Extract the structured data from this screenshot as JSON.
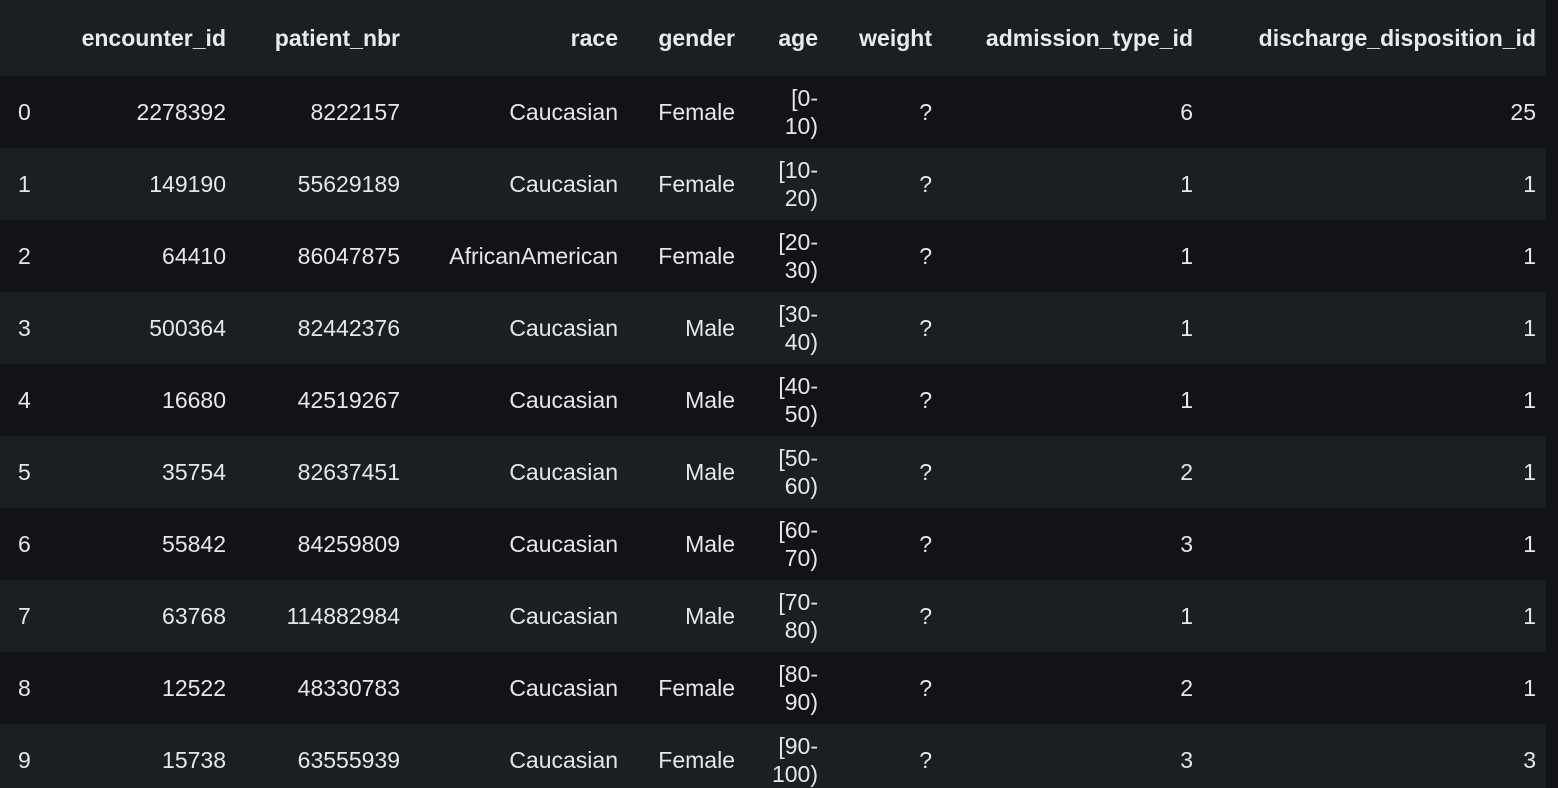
{
  "columns": {
    "index": "",
    "encounter_id": "encounter_id",
    "patient_nbr": "patient_nbr",
    "race": "race",
    "gender": "gender",
    "age": "age",
    "weight": "weight",
    "admission_type_id": "admission_type_id",
    "discharge_disposition_id": "discharge_disposition_id"
  },
  "rows": [
    {
      "index": "0",
      "encounter_id": "2278392",
      "patient_nbr": "8222157",
      "race": "Caucasian",
      "gender": "Female",
      "age_a": "[0-",
      "age_b": "10)",
      "weight": "?",
      "admission_type_id": "6",
      "discharge_disposition_id": "25"
    },
    {
      "index": "1",
      "encounter_id": "149190",
      "patient_nbr": "55629189",
      "race": "Caucasian",
      "gender": "Female",
      "age_a": "[10-",
      "age_b": "20)",
      "weight": "?",
      "admission_type_id": "1",
      "discharge_disposition_id": "1"
    },
    {
      "index": "2",
      "encounter_id": "64410",
      "patient_nbr": "86047875",
      "race": "AfricanAmerican",
      "gender": "Female",
      "age_a": "[20-",
      "age_b": "30)",
      "weight": "?",
      "admission_type_id": "1",
      "discharge_disposition_id": "1"
    },
    {
      "index": "3",
      "encounter_id": "500364",
      "patient_nbr": "82442376",
      "race": "Caucasian",
      "gender": "Male",
      "age_a": "[30-",
      "age_b": "40)",
      "weight": "?",
      "admission_type_id": "1",
      "discharge_disposition_id": "1"
    },
    {
      "index": "4",
      "encounter_id": "16680",
      "patient_nbr": "42519267",
      "race": "Caucasian",
      "gender": "Male",
      "age_a": "[40-",
      "age_b": "50)",
      "weight": "?",
      "admission_type_id": "1",
      "discharge_disposition_id": "1"
    },
    {
      "index": "5",
      "encounter_id": "35754",
      "patient_nbr": "82637451",
      "race": "Caucasian",
      "gender": "Male",
      "age_a": "[50-",
      "age_b": "60)",
      "weight": "?",
      "admission_type_id": "2",
      "discharge_disposition_id": "1"
    },
    {
      "index": "6",
      "encounter_id": "55842",
      "patient_nbr": "84259809",
      "race": "Caucasian",
      "gender": "Male",
      "age_a": "[60-",
      "age_b": "70)",
      "weight": "?",
      "admission_type_id": "3",
      "discharge_disposition_id": "1"
    },
    {
      "index": "7",
      "encounter_id": "63768",
      "patient_nbr": "114882984",
      "race": "Caucasian",
      "gender": "Male",
      "age_a": "[70-",
      "age_b": "80)",
      "weight": "?",
      "admission_type_id": "1",
      "discharge_disposition_id": "1"
    },
    {
      "index": "8",
      "encounter_id": "12522",
      "patient_nbr": "48330783",
      "race": "Caucasian",
      "gender": "Female",
      "age_a": "[80-",
      "age_b": "90)",
      "weight": "?",
      "admission_type_id": "2",
      "discharge_disposition_id": "1"
    },
    {
      "index": "9",
      "encounter_id": "15738",
      "patient_nbr": "63555939",
      "race": "Caucasian",
      "gender": "Female",
      "age_a": "[90-",
      "age_b": "100)",
      "weight": "?",
      "admission_type_id": "3",
      "discharge_disposition_id": "3"
    }
  ]
}
